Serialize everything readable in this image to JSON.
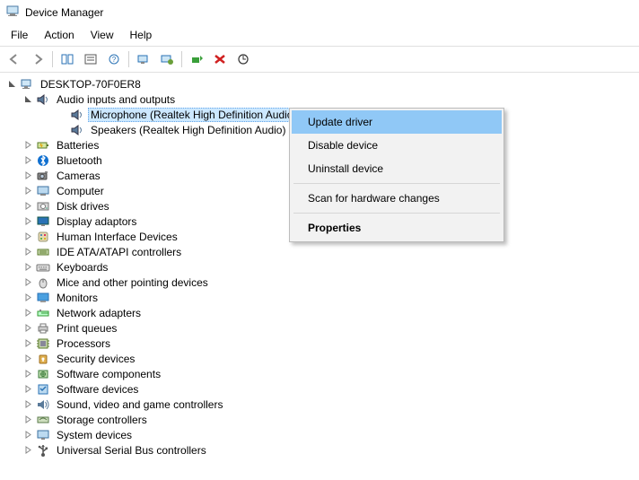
{
  "window": {
    "title": "Device Manager"
  },
  "menubar": [
    "File",
    "Action",
    "View",
    "Help"
  ],
  "toolbar_icons": [
    "back",
    "forward",
    "sep",
    "show-hide",
    "properties",
    "help",
    "sep",
    "refresh",
    "view-mode",
    "sep",
    "update-driver",
    "uninstall",
    "scan-hardware"
  ],
  "root": {
    "label": "DESKTOP-70F0ER8"
  },
  "audio_category": {
    "label": "Audio inputs and outputs"
  },
  "audio_children": [
    {
      "label": "Microphone (Realtek High Definition Audio)",
      "selected": true
    },
    {
      "label": "Speakers (Realtek High Definition Audio)",
      "selected": false
    }
  ],
  "categories": [
    {
      "label": "Batteries",
      "icon": "battery"
    },
    {
      "label": "Bluetooth",
      "icon": "bluetooth"
    },
    {
      "label": "Cameras",
      "icon": "camera"
    },
    {
      "label": "Computer",
      "icon": "computer"
    },
    {
      "label": "Disk drives",
      "icon": "disk"
    },
    {
      "label": "Display adaptors",
      "icon": "display"
    },
    {
      "label": "Human Interface Devices",
      "icon": "hid"
    },
    {
      "label": "IDE ATA/ATAPI controllers",
      "icon": "ide"
    },
    {
      "label": "Keyboards",
      "icon": "keyboard"
    },
    {
      "label": "Mice and other pointing devices",
      "icon": "mouse"
    },
    {
      "label": "Monitors",
      "icon": "monitor"
    },
    {
      "label": "Network adapters",
      "icon": "network"
    },
    {
      "label": "Print queues",
      "icon": "printer"
    },
    {
      "label": "Processors",
      "icon": "cpu"
    },
    {
      "label": "Security devices",
      "icon": "security"
    },
    {
      "label": "Software components",
      "icon": "softcomp"
    },
    {
      "label": "Software devices",
      "icon": "softdev"
    },
    {
      "label": "Sound, video and game controllers",
      "icon": "sound"
    },
    {
      "label": "Storage controllers",
      "icon": "storage"
    },
    {
      "label": "System devices",
      "icon": "system"
    },
    {
      "label": "Universal Serial Bus controllers",
      "icon": "usb"
    }
  ],
  "context_menu": {
    "items": [
      {
        "label": "Update driver",
        "highlighted": true
      },
      {
        "label": "Disable device"
      },
      {
        "label": "Uninstall device"
      },
      {
        "sep": true
      },
      {
        "label": "Scan for hardware changes"
      },
      {
        "sep": true
      },
      {
        "label": "Properties",
        "bold": true
      }
    ]
  }
}
